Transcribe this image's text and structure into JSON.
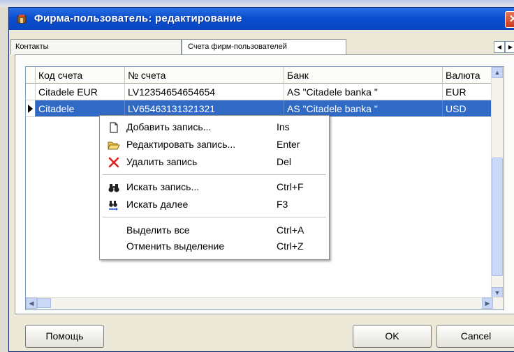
{
  "window": {
    "title": "Фирма-пользователь: редактирование",
    "close_glyph": "✕"
  },
  "tabs": [
    {
      "label": "Контакты",
      "active": false
    },
    {
      "label": "Счета фирм-пользователей",
      "active": true
    }
  ],
  "tab_scroll": {
    "left": "◀",
    "right": "▶"
  },
  "grid": {
    "columns": [
      "Код счета",
      "№ счета",
      "Банк",
      "Валюта"
    ],
    "rows": [
      {
        "code": "Citadele EUR",
        "account": "LV12354654654654",
        "bank": "AS \"Citadele banka \"",
        "currency": "EUR",
        "selected": false
      },
      {
        "code": "Citadele",
        "account": "LV65463131321321",
        "bank": "AS \"Citadele banka \"",
        "currency": "USD",
        "selected": true
      }
    ]
  },
  "scroll": {
    "up": "▲",
    "down": "▼",
    "left": "◀",
    "right": "▶"
  },
  "context_menu": {
    "items": [
      {
        "icon": "new-document-icon",
        "label": "Добавить запись...",
        "shortcut": "Ins"
      },
      {
        "icon": "open-folder-icon",
        "label": "Редактировать запись...",
        "shortcut": "Enter"
      },
      {
        "icon": "delete-x-icon",
        "label": "Удалить запись",
        "shortcut": "Del"
      },
      {
        "icon": "binoculars-icon",
        "label": "Искать запись...",
        "shortcut": "Ctrl+F"
      },
      {
        "icon": "find-next-icon",
        "label": "Искать далее",
        "shortcut": "F3"
      },
      {
        "icon": "",
        "label": "Выделить все",
        "shortcut": "Ctrl+A"
      },
      {
        "icon": "",
        "label": "Отменить выделение",
        "shortcut": "Ctrl+Z"
      }
    ]
  },
  "buttons": {
    "help": "Помощь",
    "ok": "OK",
    "cancel": "Cancel"
  },
  "colors": {
    "titlebar": "#0b4fd0",
    "selection": "#316ac5",
    "close": "#c8391d"
  }
}
